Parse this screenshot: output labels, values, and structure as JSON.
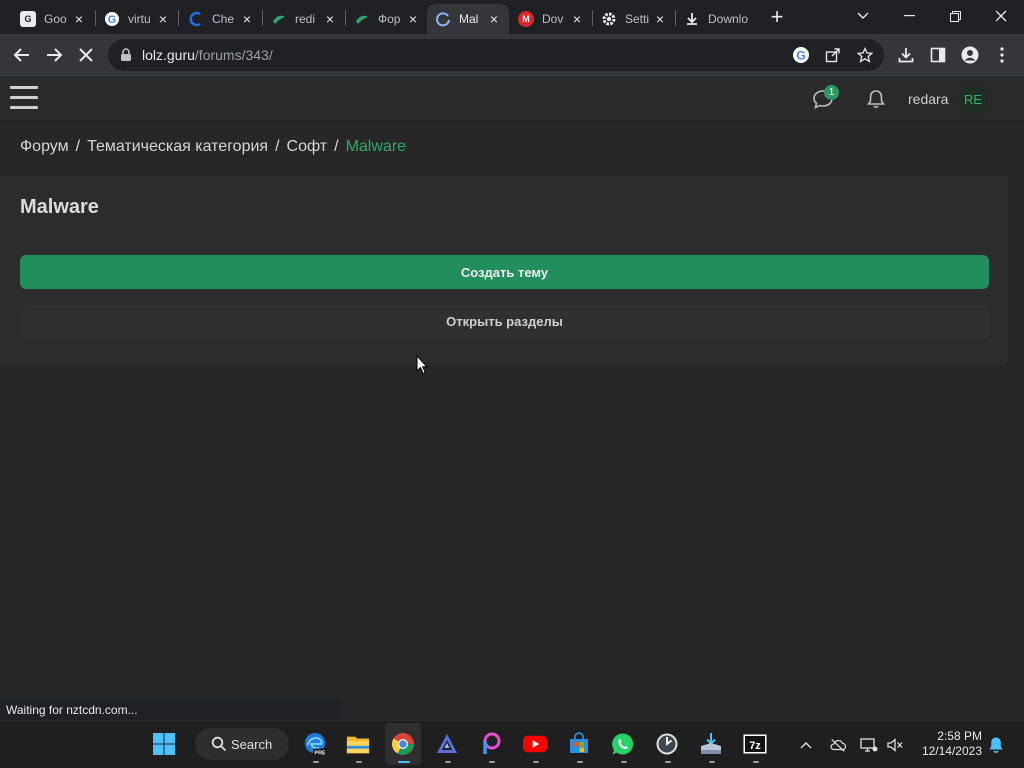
{
  "browser": {
    "tabs": [
      {
        "title": "Goo",
        "icon": "google-docs-icon",
        "color": "#e8eaed",
        "active": false
      },
      {
        "title": "virtu",
        "icon": "google-icon",
        "color": "#4285f4",
        "active": false
      },
      {
        "title": "Che",
        "icon": "codeium-icon",
        "color": "#1f6feb",
        "active": false
      },
      {
        "title": "redi",
        "icon": "lolz-icon",
        "color": "#2ba869",
        "active": false
      },
      {
        "title": "Фор",
        "icon": "lolz-icon",
        "color": "#2ba869",
        "active": false
      },
      {
        "title": "Mal",
        "icon": "loading-icon",
        "color": "#8ab4f8",
        "active": true
      },
      {
        "title": "Dov",
        "icon": "mega-icon",
        "color": "#d9272e",
        "active": false
      },
      {
        "title": "Setti",
        "icon": "gear-icon",
        "color": "#e8eaed",
        "active": false
      },
      {
        "title": "Downlo",
        "icon": "download-icon",
        "color": "#e8eaed",
        "active": false
      }
    ],
    "url_host": "lolz.guru",
    "url_path": "/forums/343/",
    "status_text": "Waiting for nztcdn.com..."
  },
  "site": {
    "messages_badge": "1",
    "username": "redara",
    "avatar_initials": "RE",
    "accent": "#2ba869"
  },
  "breadcrumb": {
    "items": [
      "Форум",
      "Тематическая категория",
      "Софт"
    ],
    "separator": "/",
    "current": "Malware"
  },
  "main": {
    "title": "Malware",
    "create_button": "Создать тему",
    "open_sections_button": "Открыть разделы"
  },
  "taskbar": {
    "search_label": "Search",
    "time": "2:58 PM",
    "date": "12/14/2023"
  }
}
